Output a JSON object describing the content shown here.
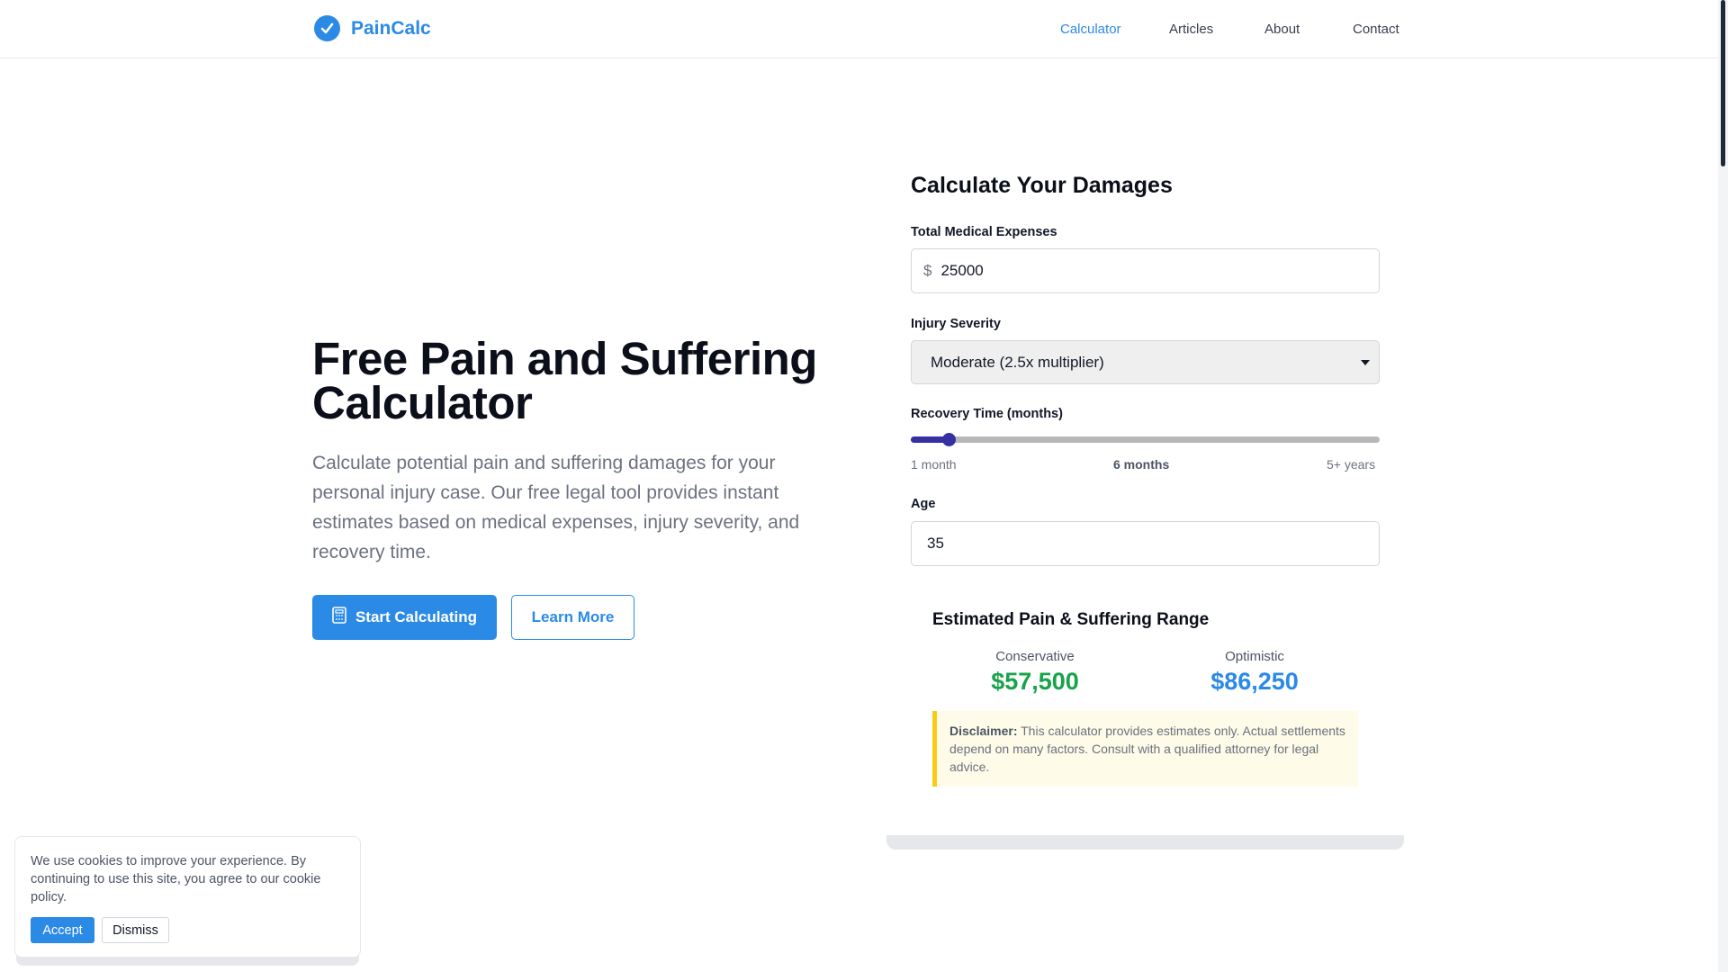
{
  "header": {
    "brand": "PainCalc",
    "nav": [
      "Calculator",
      "Articles",
      "About",
      "Contact"
    ],
    "active_nav": "Calculator"
  },
  "hero": {
    "title": "Free Pain and Suffering Calculator",
    "description": "Calculate potential pain and suffering damages for your personal injury case. Our free legal tool provides instant estimates based on medical expenses, injury severity, and recovery time.",
    "primary_button": "Start Calculating",
    "secondary_button": "Learn More"
  },
  "calculator": {
    "title": "Calculate Your Damages",
    "medical": {
      "label": "Total Medical Expenses",
      "prefix": "$",
      "value": "25000"
    },
    "severity": {
      "label": "Injury Severity",
      "value": "Moderate (2.5x multiplier)"
    },
    "recovery": {
      "label": "Recovery Time (months)",
      "min_label": "1 month",
      "current_label": "6 months",
      "max_label": "5+ years",
      "level": 0.08
    },
    "age": {
      "label": "Age",
      "value": "35"
    },
    "results": {
      "title": "Estimated Pain & Suffering Range",
      "conservative_label": "Conservative",
      "conservative_value": "$57,500",
      "optimistic_label": "Optimistic",
      "optimistic_value": "$86,250"
    },
    "disclaimer": {
      "bold": "Disclaimer:",
      "text": "This calculator provides estimates only. Actual settlements depend on many factors. Consult with a qualified attorney for legal advice."
    }
  },
  "cookie": {
    "text": "We use cookies to improve your experience. By continuing to use this site, you agree to our cookie policy.",
    "accept": "Accept",
    "dismiss": "Dismiss"
  },
  "colors": {
    "accent": "#2b8ae6",
    "slider": "#3730a3",
    "conservative": "#16a34a",
    "disclaimer_border": "#facc15"
  },
  "icons": [
    "check-circle-icon",
    "calculator-icon",
    "chevron-down-icon"
  ]
}
